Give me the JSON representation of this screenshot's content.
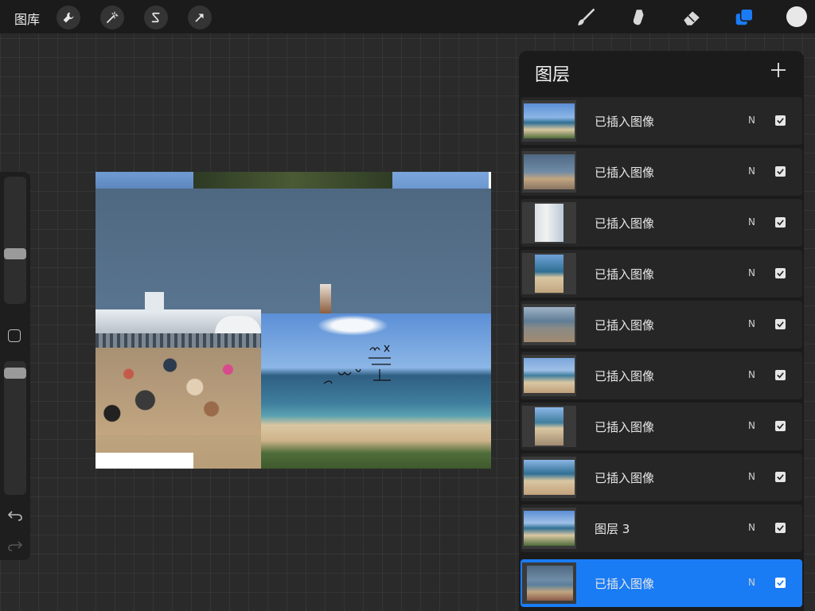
{
  "toolbar": {
    "gallery_label": "图库",
    "left_tools": [
      {
        "name": "actions",
        "icon": "wrench-icon"
      },
      {
        "name": "adjustments",
        "icon": "magic-wand-icon"
      },
      {
        "name": "selection",
        "icon": "selection-s-icon"
      },
      {
        "name": "transform",
        "icon": "arrow-cursor-icon"
      }
    ],
    "right_tools": [
      {
        "name": "brush",
        "icon": "brush-icon"
      },
      {
        "name": "smudge",
        "icon": "smudge-icon"
      },
      {
        "name": "eraser",
        "icon": "eraser-icon"
      },
      {
        "name": "layers",
        "icon": "layers-icon",
        "active": true
      }
    ],
    "current_color": "#e8e8e8",
    "accent_color": "#1a7cf5"
  },
  "sidebar": {
    "brush_size_icon": "slider-thumb",
    "opacity_icon": "slider-thumb",
    "modify_icon": "square-icon",
    "undo_icon": "undo-icon",
    "redo_icon": "redo-icon"
  },
  "layers_panel": {
    "title": "图层",
    "add_icon": "plus-icon",
    "layers": [
      {
        "name": "已插入图像",
        "blend": "N",
        "visible": true,
        "active": false
      },
      {
        "name": "已插入图像",
        "blend": "N",
        "visible": true,
        "active": false
      },
      {
        "name": "已插入图像",
        "blend": "N",
        "visible": true,
        "active": false
      },
      {
        "name": "已插入图像",
        "blend": "N",
        "visible": true,
        "active": false
      },
      {
        "name": "已插入图像",
        "blend": "N",
        "visible": true,
        "active": false
      },
      {
        "name": "已插入图像",
        "blend": "N",
        "visible": true,
        "active": false
      },
      {
        "name": "已插入图像",
        "blend": "N",
        "visible": true,
        "active": false
      },
      {
        "name": "已插入图像",
        "blend": "N",
        "visible": true,
        "active": false
      },
      {
        "name": "图层 3",
        "blend": "N",
        "visible": true,
        "active": false
      },
      {
        "name": "已插入图像",
        "blend": "N",
        "visible": true,
        "active": true
      }
    ]
  }
}
